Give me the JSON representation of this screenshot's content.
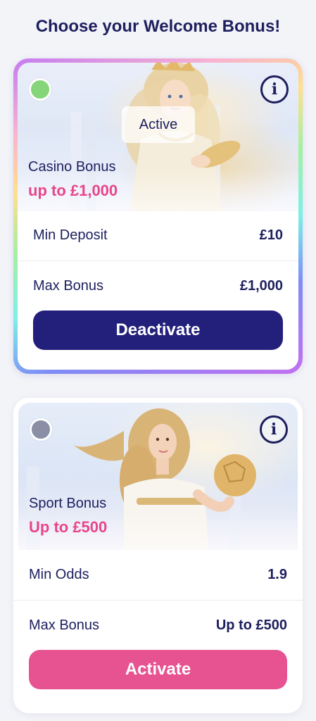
{
  "page": {
    "title": "Choose your Welcome Bonus!"
  },
  "cards": [
    {
      "status_color": "#86d57a",
      "status_label": "Active",
      "name": "Casino Bonus",
      "amount": "up to £1,000",
      "rows": [
        {
          "label": "Min Deposit",
          "value": "£10"
        },
        {
          "label": "Max Bonus",
          "value": "£1,000"
        }
      ],
      "button_label": "Deactivate",
      "button_color": "#22207a",
      "info_icon": "info-icon"
    },
    {
      "status_color": "#8a8fa5",
      "name": "Sport Bonus",
      "amount": "Up to £500",
      "rows": [
        {
          "label": "Min Odds",
          "value": "1.9"
        },
        {
          "label": "Max Bonus",
          "value": "Up to £500"
        }
      ],
      "button_label": "Activate",
      "button_color": "#e75290",
      "info_icon": "info-icon"
    }
  ],
  "colors": {
    "heading": "#1d1f5e",
    "accent_pink": "#e8458b"
  }
}
